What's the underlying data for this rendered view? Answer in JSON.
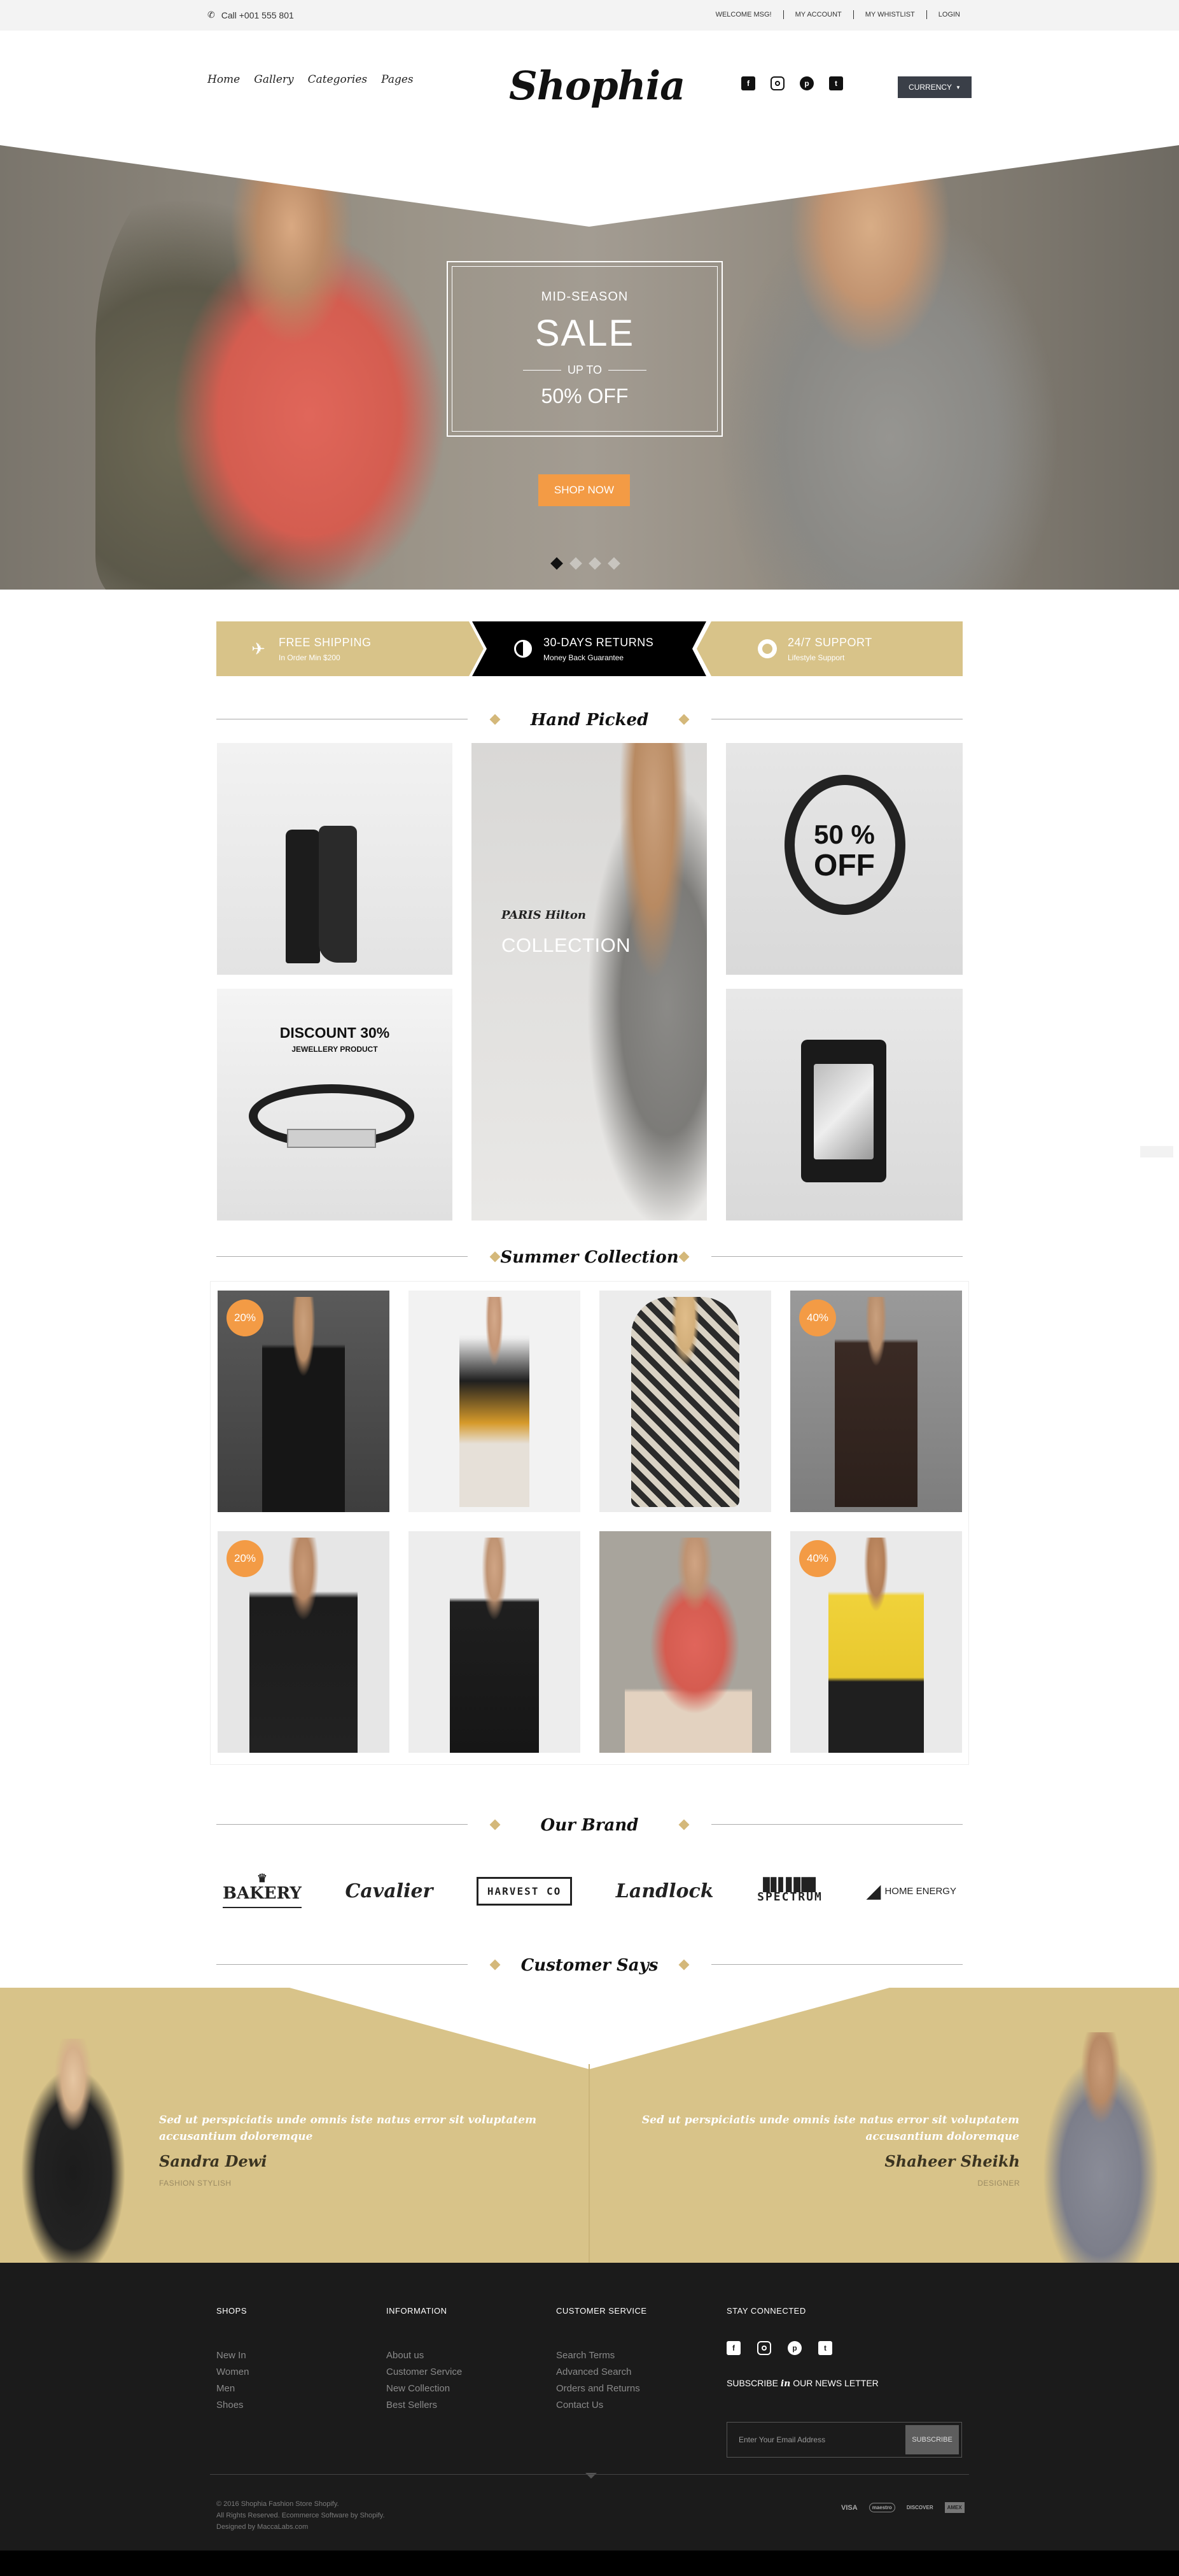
{
  "topbar": {
    "phone": "Call +001 555 801",
    "links": [
      "WELCOME MSG!",
      "MY ACCOUNT",
      "MY WHISTLIST",
      "LOGIN"
    ]
  },
  "header": {
    "nav": [
      "Home",
      "Gallery",
      "Categories",
      "Pages"
    ],
    "logo": "Shophia",
    "currency": "CURRENCY"
  },
  "hero": {
    "line1": "MID-SEASON",
    "line2": "SALE",
    "line3": "UP TO",
    "line4": "50% OFF",
    "cta": "SHOP NOW",
    "slides": 4,
    "active_slide": 1
  },
  "features": [
    {
      "title": "FREE SHIPPING",
      "sub": "In Order Min $200",
      "icon": "plane-icon"
    },
    {
      "title": "30-DAYS RETURNS",
      "sub": "Money Back Guarantee",
      "icon": "half-circle-icon"
    },
    {
      "title": "24/7 SUPPORT",
      "sub": "Lifestyle Support",
      "icon": "lifebuoy-icon"
    }
  ],
  "sections": {
    "hand_picked": "Hand Picked",
    "summer": "Summer Collection",
    "brand": "Our Brand",
    "customer": "Customer Says"
  },
  "hand_picked": {
    "center_small": "PARIS Hilton",
    "center_big": "COLLECTION",
    "bracelet_sale": "50 %",
    "bracelet_off": "OFF",
    "discount": "DISCOUNT 30%",
    "discount_sub": "JEWELLERY PRODUCT"
  },
  "products": [
    {
      "badge": "20%"
    },
    {
      "badge": ""
    },
    {
      "badge": ""
    },
    {
      "badge": "40%"
    },
    {
      "badge": "20%"
    },
    {
      "badge": ""
    },
    {
      "badge": ""
    },
    {
      "badge": "40%"
    }
  ],
  "brands": [
    "BAKERY",
    "Cavalier",
    "HARVEST CO",
    "Landlock",
    "SPECTRUM",
    "HOME ENERGY"
  ],
  "testimonials": [
    {
      "quote": "Sed ut perspiciatis unde omnis iste natus error sit voluptatem accusantium doloremque",
      "name": "Sandra Dewi",
      "role": "FASHION STYLISH"
    },
    {
      "quote": "Sed ut perspiciatis unde omnis iste natus error sit voluptatem accusantium doloremque",
      "name": "Shaheer Sheikh",
      "role": "DESIGNER"
    }
  ],
  "footer": {
    "shops": {
      "title": "SHOPS",
      "items": [
        "New In",
        "Women",
        "Men",
        "Shoes"
      ]
    },
    "info": {
      "title": "INFORMATION",
      "items": [
        "About us",
        "Customer Service",
        "New Collection",
        "Best Sellers"
      ]
    },
    "service": {
      "title": "CUSTOMER SERVICE",
      "items": [
        "Search Terms",
        "Advanced Search",
        "Orders and Returns",
        "Contact Us"
      ]
    },
    "stay": {
      "title": "STAY CONNECTED"
    },
    "subscribe_pre": "SUBSCRIBE",
    "subscribe_in": "in",
    "subscribe_post": "OUR NEWS LETTER",
    "email_placeholder": "Enter Your Email Address",
    "subscribe_btn": "SUBSCRIBE",
    "copy": [
      "© 2016 Shophia Fashion Store Shopify.",
      "All Rights Reserved. Ecommerce Software by Shopify.",
      "Designed by MaccaLabs.com"
    ],
    "payments": [
      "VISA",
      "maestro",
      "DISCOVER",
      "AMEX"
    ]
  },
  "colors": {
    "accent": "#d8c389",
    "orange": "#f39b45",
    "dark": "#1b1b1b"
  }
}
